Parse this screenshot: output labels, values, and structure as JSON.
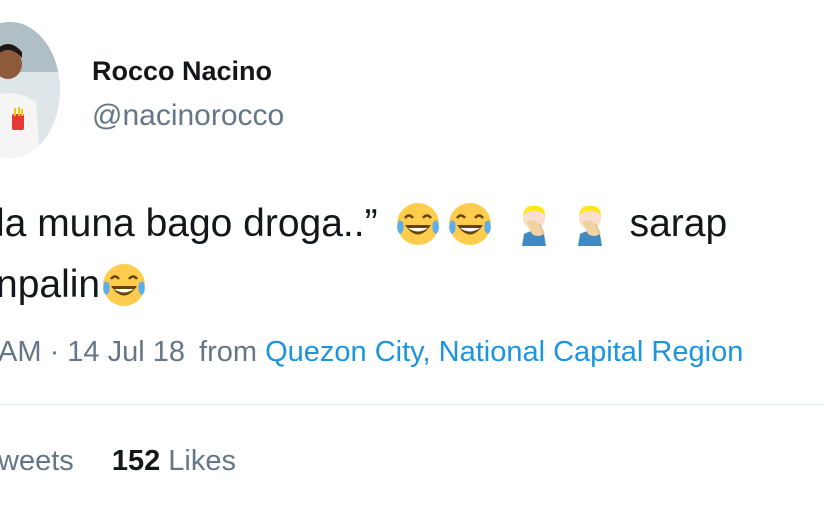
{
  "tweet": {
    "author_name": "Rocco Nacino",
    "author_handle": "@nacinorocco",
    "text_line1_part1": "la muna bago droga..”",
    "text_line1_part2": "sarap",
    "text_line2": "npalin",
    "emojis": [
      "tears-of-joy-emoji",
      "tears-of-joy-emoji",
      "facepalm-emoji",
      "facepalm-emoji",
      "tears-of-joy-emoji"
    ],
    "time_fragment": "AM",
    "date": "14 Jul 18",
    "from_label": "from",
    "location": "Quezon City, National Capital Region"
  },
  "stats": {
    "retweets_label_fragment": "weets",
    "likes_count": "152",
    "likes_label": "Likes"
  },
  "colors": {
    "text": "#14171a",
    "secondary": "#657786",
    "link": "#1b95e0",
    "divider": "#e1e8ed"
  }
}
